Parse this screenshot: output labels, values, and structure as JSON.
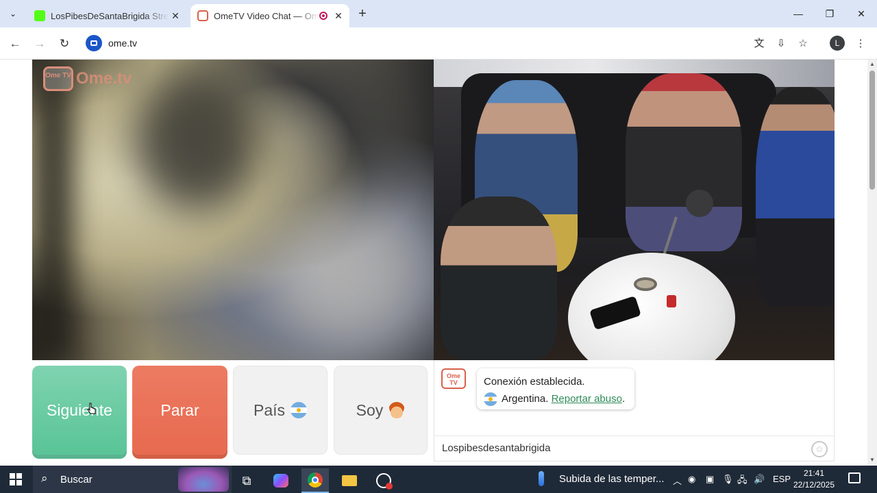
{
  "browser": {
    "tabs": [
      {
        "title": "LosPibesDeSantaBrigida Stream",
        "active": false
      },
      {
        "title": "OmeTV Video Chat — Ome",
        "active": true
      }
    ],
    "new_tab_label": "+",
    "url": "ome.tv",
    "profile_initial": "L",
    "accent_color": "#1a56c8"
  },
  "app": {
    "logo_tv": "Ome TV",
    "logo_name": "Ome.tv",
    "buttons": {
      "next": "Siguiente",
      "stop": "Parar",
      "country": "País",
      "gender": "Soy"
    },
    "button_colors": {
      "next": "#59c497",
      "stop": "#e76a4f"
    },
    "chat": {
      "logo": "Ome TV",
      "status": "Conexión establecida.",
      "country": "Argentina.",
      "report_link": "Reportar abuso",
      "input_value": "Lospibesdesantabrigida"
    }
  },
  "taskbar": {
    "search_text": "Buscar",
    "weather_text": "Subida de las temper...",
    "language": "ESP",
    "time": "21:41",
    "date": "22/12/2025"
  }
}
